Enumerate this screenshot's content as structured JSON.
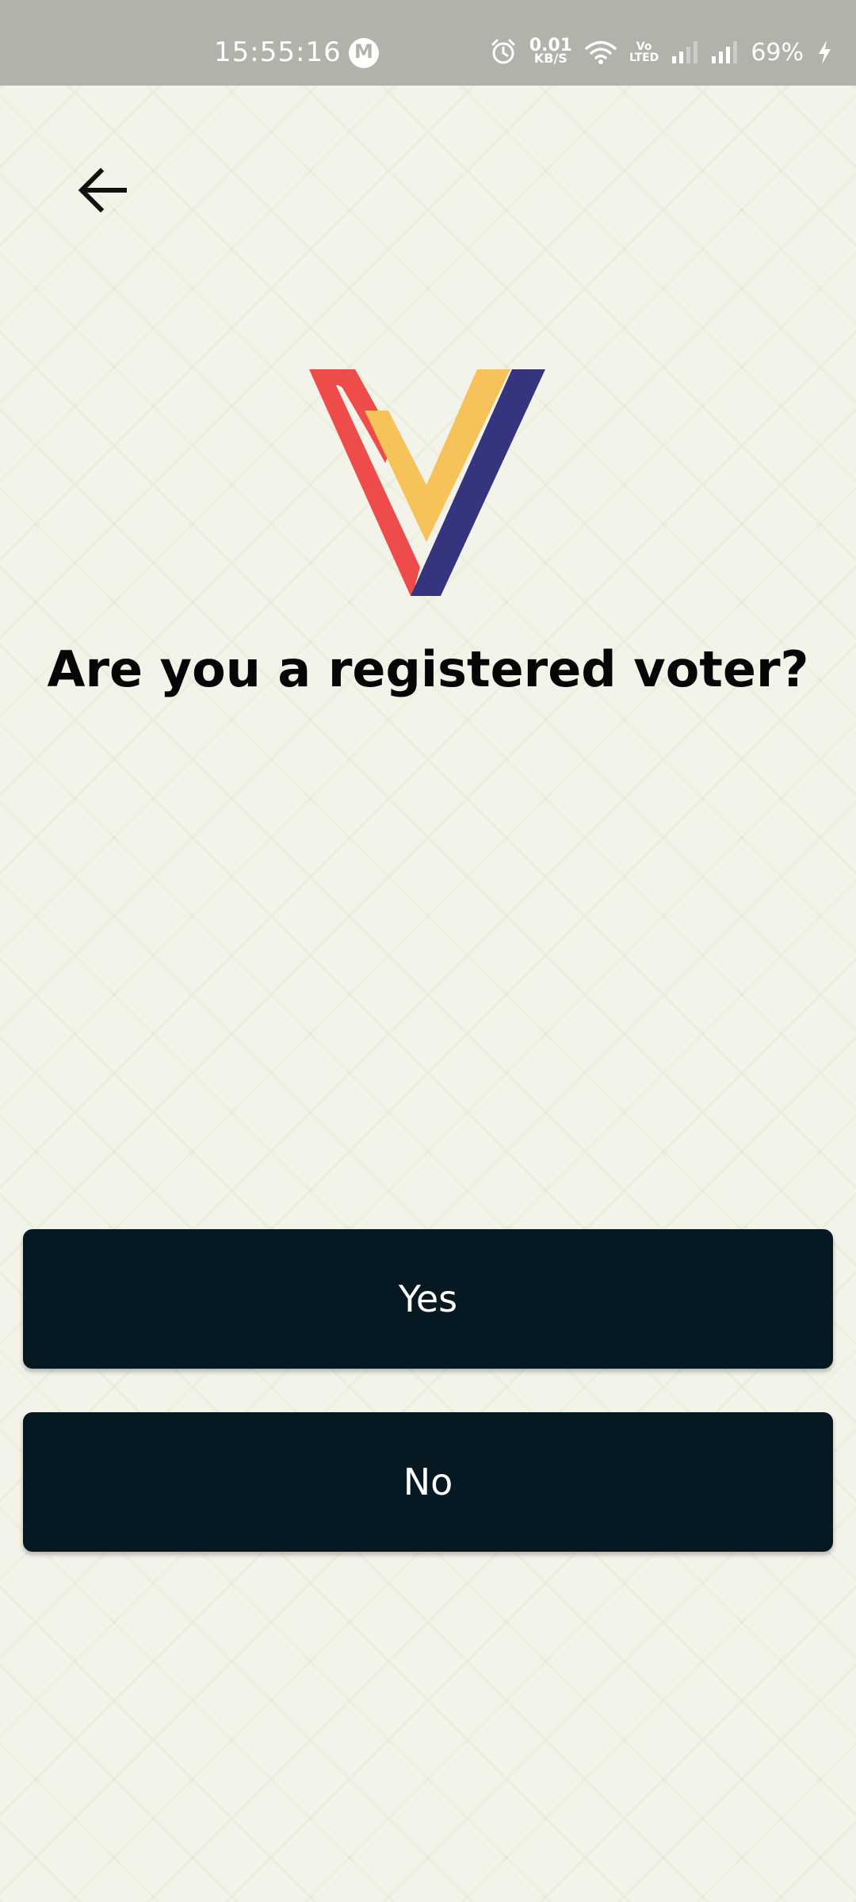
{
  "status_bar": {
    "time": "15:55:16",
    "m_badge": "M",
    "net_speed_value": "0.01",
    "net_speed_unit": "KB/S",
    "volte_top": "Vo",
    "volte_bottom": "LTED",
    "battery": "69%"
  },
  "icons": {
    "back": "arrow-left-icon",
    "alarm": "alarm-icon",
    "wifi": "wifi-icon",
    "signal": "signal-icon",
    "charging": "lightning-icon"
  },
  "colors": {
    "logo_red": "#ee4b4b",
    "logo_yellow": "#f7c25a",
    "logo_navy": "#35357f",
    "button_bg": "#061821",
    "background": "#f3f3ea"
  },
  "screen": {
    "question": "Are you a registered voter?",
    "yes_label": "Yes",
    "no_label": "No"
  }
}
